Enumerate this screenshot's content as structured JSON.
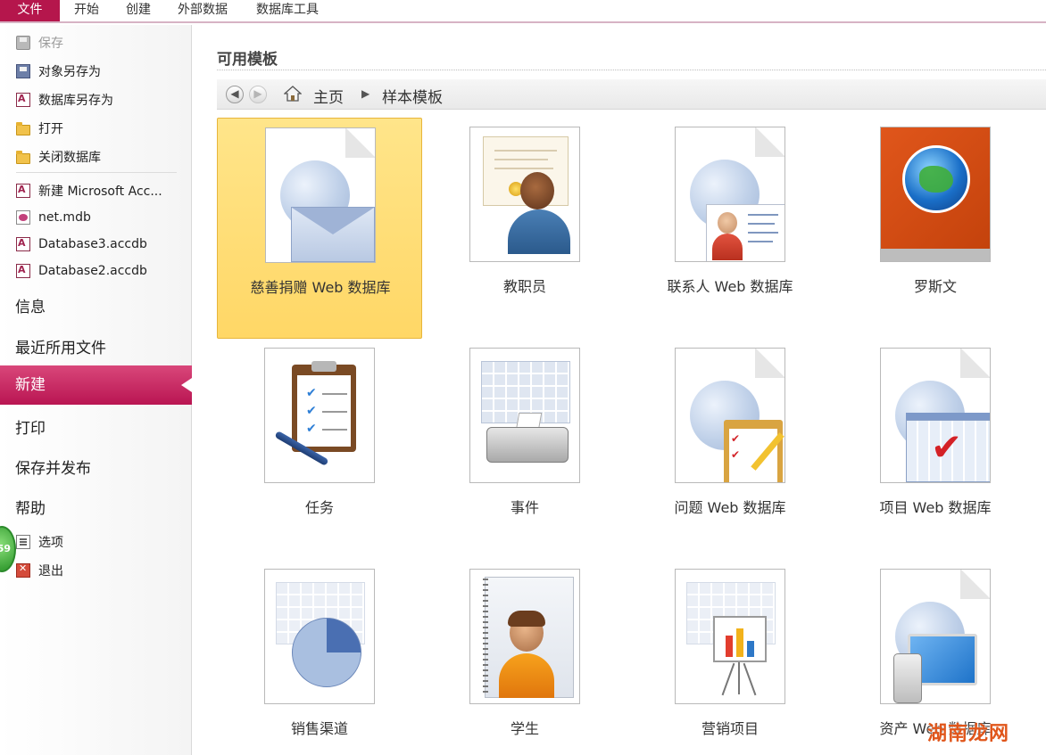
{
  "ribbon": {
    "tabs": [
      "文件",
      "开始",
      "创建",
      "外部数据",
      "数据库工具"
    ]
  },
  "sidebar": {
    "commands": [
      {
        "label": "保存",
        "icon": "save-icon"
      },
      {
        "label": "对象另存为",
        "icon": "save-object-as-icon"
      },
      {
        "label": "数据库另存为",
        "icon": "save-database-as-icon"
      },
      {
        "label": "打开",
        "icon": "open-folder-icon"
      },
      {
        "label": "关闭数据库",
        "icon": "close-database-icon"
      }
    ],
    "recent": [
      {
        "label": "新建 Microsoft Acc...",
        "icon": "access-file-icon"
      },
      {
        "label": "net.mdb",
        "icon": "mdb-file-icon"
      },
      {
        "label": "Database3.accdb",
        "icon": "access-file-icon"
      },
      {
        "label": "Database2.accdb",
        "icon": "access-file-icon"
      }
    ],
    "nav": [
      "信息",
      "最近所用文件",
      "新建",
      "打印",
      "保存并发布",
      "帮助"
    ],
    "active_nav": "新建",
    "footer": [
      {
        "label": "选项",
        "icon": "options-icon"
      },
      {
        "label": "退出",
        "icon": "exit-icon"
      }
    ],
    "badge": "59"
  },
  "main": {
    "section_title": "可用模板",
    "breadcrumb": [
      "主页",
      "样本模板"
    ],
    "templates": [
      {
        "label": "慈善捐赠 Web 数据库",
        "icon": "charity-web-database-icon",
        "selected": true
      },
      {
        "label": "教职员",
        "icon": "faculty-icon"
      },
      {
        "label": "联系人 Web 数据库",
        "icon": "contacts-web-database-icon"
      },
      {
        "label": "罗斯文",
        "icon": "northwind-icon"
      },
      {
        "label": "任务",
        "icon": "tasks-clipboard-icon"
      },
      {
        "label": "事件",
        "icon": "events-icon"
      },
      {
        "label": "问题 Web 数据库",
        "icon": "issues-web-database-icon"
      },
      {
        "label": "项目 Web 数据库",
        "icon": "projects-web-database-icon"
      },
      {
        "label": "销售渠道",
        "icon": "sales-pipeline-icon"
      },
      {
        "label": "学生",
        "icon": "students-icon"
      },
      {
        "label": "营销项目",
        "icon": "marketing-projects-icon"
      },
      {
        "label": "资产 Web 数据库",
        "icon": "assets-web-database-icon"
      }
    ]
  },
  "watermark": "湖南龙网",
  "colors": {
    "file_tab": "#b5164c",
    "active_nav": "#c72a61",
    "selected_tile": "#ffde72"
  }
}
